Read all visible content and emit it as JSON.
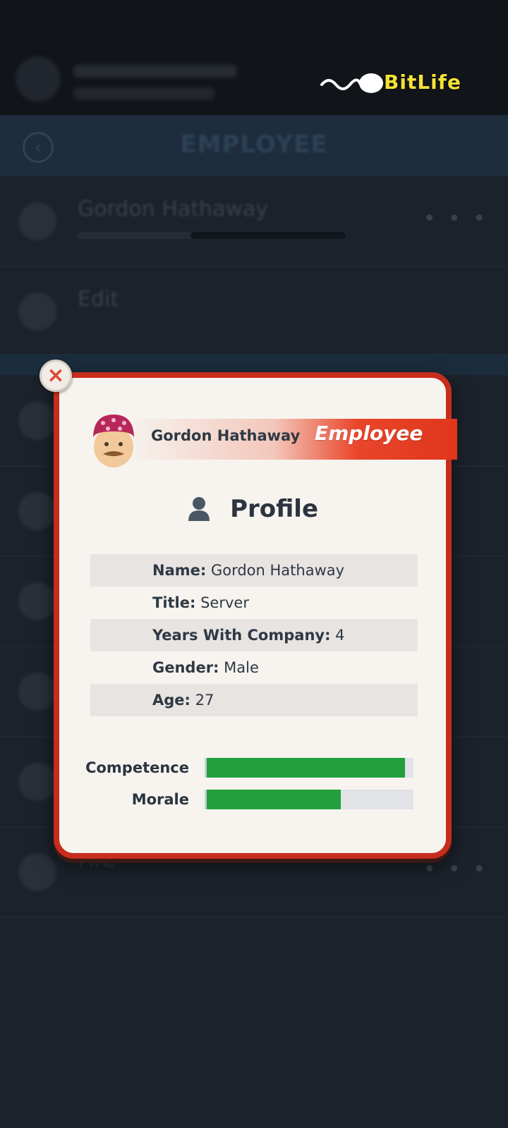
{
  "app": {
    "brand_name": "BitLife"
  },
  "nav": {
    "title": "EMPLOYEE"
  },
  "background_rows": [
    {
      "title": "Gordon Hathaway",
      "more": "• • •"
    },
    {
      "title": "Edit",
      "more": ""
    },
    {
      "title": "Fire",
      "more": "• • •"
    }
  ],
  "modal": {
    "close_label": "×",
    "employee_name": "Gordon Hathaway",
    "role_label": "Employee",
    "section_title": "Profile",
    "profile": [
      {
        "key": "Name:",
        "value": "Gordon Hathaway"
      },
      {
        "key": "Title:",
        "value": "Server"
      },
      {
        "key": "Years With Company:",
        "value": "4"
      },
      {
        "key": "Gender:",
        "value": "Male"
      },
      {
        "key": "Age:",
        "value": "27"
      }
    ],
    "stats": [
      {
        "label": "Competence",
        "value_percent": 96
      },
      {
        "label": "Morale",
        "value_percent": 65
      }
    ]
  },
  "colors": {
    "accent_red": "#c72d1d",
    "bar_green": "#22a03d",
    "brand_yellow": "#f4e236"
  }
}
